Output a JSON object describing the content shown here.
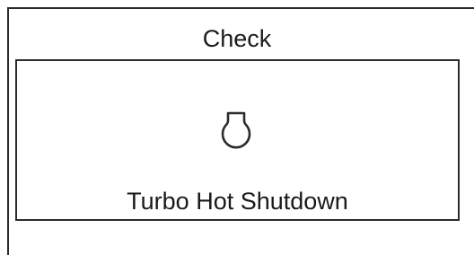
{
  "panel": {
    "title": "Check"
  },
  "message": {
    "icon": "turbo-icon",
    "text": "Turbo Hot Shutdown"
  },
  "colors": {
    "stroke": "#2b2b2b",
    "text": "#1a1a1a",
    "background": "#ffffff"
  }
}
